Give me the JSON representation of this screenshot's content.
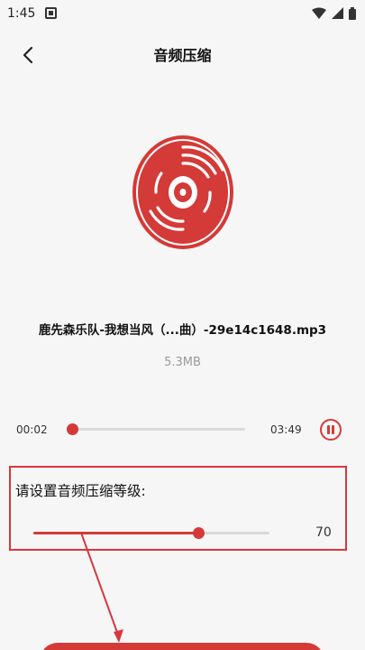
{
  "status_bar": {
    "time": "1:45",
    "icons": [
      "notification-icon",
      "wifi-icon",
      "signal-icon",
      "battery-icon"
    ]
  },
  "header": {
    "title": "音频压缩",
    "back_icon": "chevron-left-icon"
  },
  "file": {
    "icon": "vinyl-disc-icon",
    "name": "鹿先森乐队-我想当风（...曲）-29e14c1648.mp3",
    "size": "5.3MB"
  },
  "player": {
    "current_time": "00:02",
    "total_time": "03:49",
    "progress_fraction": 0.02,
    "state_icon": "pause-icon"
  },
  "compression": {
    "label": "请设置音频压缩等级:",
    "level": "70",
    "level_fraction": 0.7
  },
  "colors": {
    "accent": "#d43a37",
    "annotation": "#d9363e",
    "background": "#f6f6f6",
    "track": "#d9d9d9"
  }
}
